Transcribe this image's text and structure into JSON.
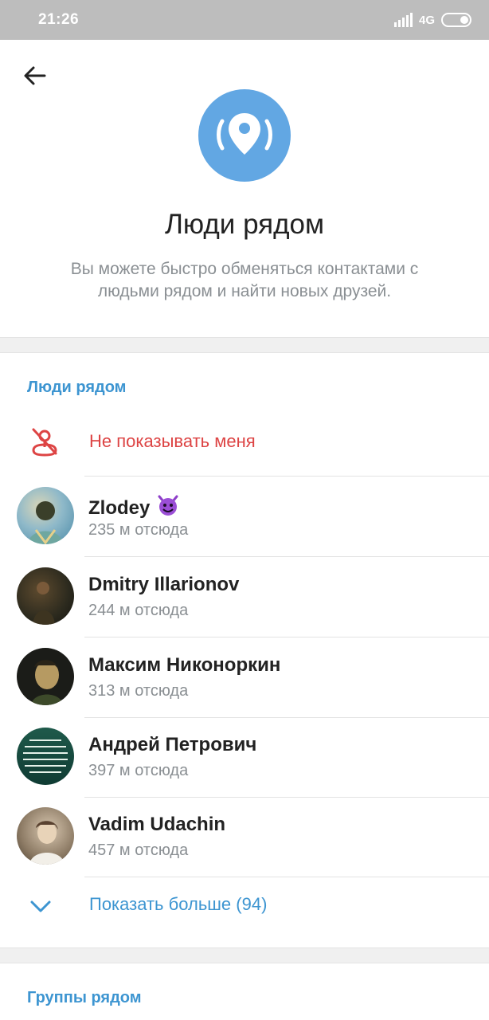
{
  "statusbar": {
    "time": "21:26",
    "network": "4G"
  },
  "header": {
    "title": "Люди рядом",
    "subtitle": "Вы можете быстро обменяться контактами с людьми рядом и найти новых друзей."
  },
  "people_section": {
    "header": "Люди рядом",
    "hide_me_label": "Не показывать меня",
    "people": [
      {
        "name": "Zlodey",
        "distance": "235 м отсюда",
        "emoji": "smiling-devil-emoji",
        "avatar_colors": [
          "#6aa9c9",
          "#d9d6b8"
        ]
      },
      {
        "name": "Dmitry Illarionov",
        "distance": "244 м отсюда",
        "avatar_colors": [
          "#2c2a1e",
          "#5d4a2e"
        ]
      },
      {
        "name": "Максим Никоноркин",
        "distance": "313 м отсюда",
        "avatar_colors": [
          "#1b1c18",
          "#b69a62"
        ]
      },
      {
        "name": "Андрей Петрович",
        "distance": "397 м отсюда",
        "avatar_colors": [
          "#0f3b33",
          "#2e6b57"
        ]
      },
      {
        "name": "Vadim Udachin",
        "distance": "457 м отсюда",
        "avatar_colors": [
          "#5a4d3e",
          "#d8c7b0"
        ]
      }
    ],
    "show_more_label": "Показать больше (94)"
  },
  "groups_section": {
    "header": "Группы рядом"
  },
  "colors": {
    "accent": "#3d95d1",
    "danger": "#dd4444",
    "icon_circle": "#62a7e3",
    "statusbar": "#bdbdbd"
  }
}
